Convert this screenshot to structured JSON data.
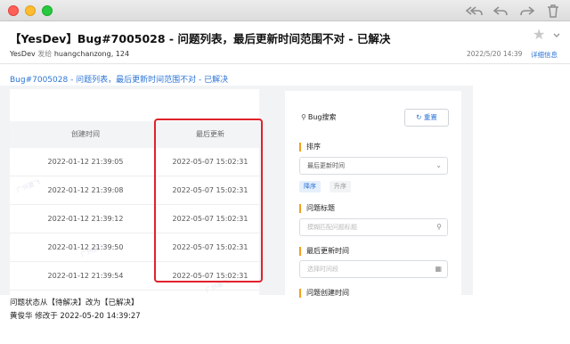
{
  "window": {
    "buttons": [
      "close",
      "minimize",
      "zoom"
    ]
  },
  "toolbar": {
    "icons": [
      "reply-all-icon",
      "reply-icon",
      "forward-icon",
      "trash-icon"
    ]
  },
  "mail": {
    "subject": "【YesDev】Bug#7005028 - 问题列表，最后更新时间范围不对 - 已解决",
    "sender_name": "YesDev",
    "sent_to_label": "发给",
    "recipients": "huangchanzong, 124",
    "date": "2022/5/20  14:39",
    "details_label": "详细信息",
    "link_text": "Bug#7005028 - 问题列表，最后更新时间范围不对 - 已解决"
  },
  "table": {
    "headers": [
      "创建时间",
      "最后更新"
    ],
    "rows": [
      [
        "2022-01-12 21:39:05",
        "2022-05-07 15:02:31"
      ],
      [
        "2022-01-12 21:39:08",
        "2022-05-07 15:02:31"
      ],
      [
        "2022-01-12 21:39:12",
        "2022-05-07 15:02:31"
      ],
      [
        "2022-01-12 21:39:50",
        "2022-05-07 15:02:31"
      ],
      [
        "2022-01-12 21:39:54",
        "2022-05-07 15:02:31"
      ]
    ]
  },
  "search": {
    "title": "Bug搜索",
    "reset_label": "重置",
    "sort_label": "排序",
    "sort_value": "最后更新时间",
    "order_desc": "降序",
    "order_asc": "升序",
    "title_label": "问题标题",
    "title_placeholder": "模糊匹配问题标题",
    "updated_label": "最后更新时间",
    "updated_placeholder": "选择时间段",
    "created_label": "问题创建时间"
  },
  "watermark": "广州夏飞",
  "footer": {
    "status_change": "问题状态从【待解决】改为【已解决】",
    "modified_by": "黄俊华 修改于 2022-05-20 14:39:27"
  },
  "colors": {
    "link": "#2e75d6",
    "highlight": "#e1212b",
    "accent": "#f0a020"
  }
}
